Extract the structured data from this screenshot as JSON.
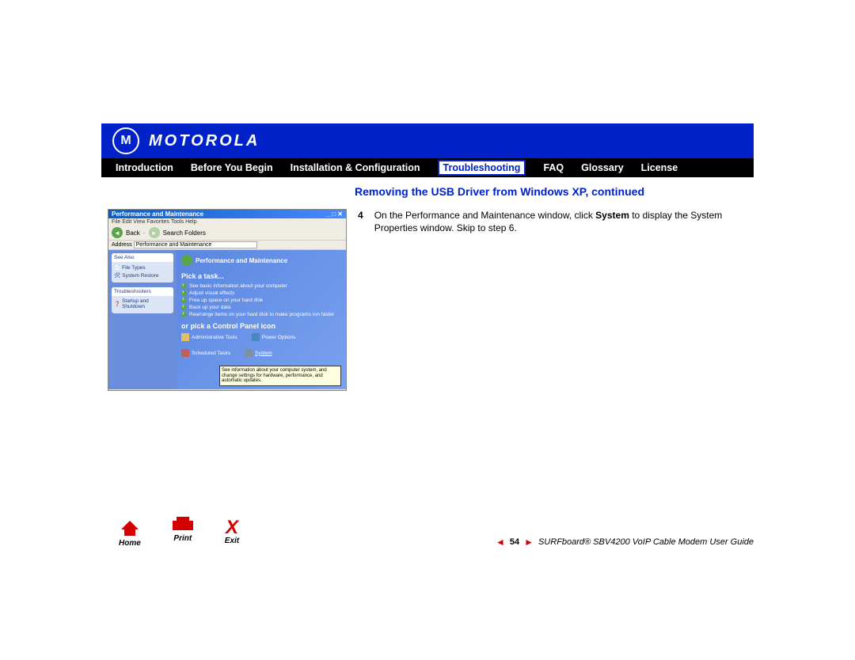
{
  "brand": "MOTOROLA",
  "nav": {
    "items": [
      "Introduction",
      "Before You Begin",
      "Installation & Configuration",
      "Troubleshooting",
      "FAQ",
      "Glossary",
      "License"
    ],
    "active_index": 3
  },
  "section_title": "Removing the USB Driver from Windows XP, continued",
  "step": {
    "number": "4",
    "text_before": "On the Performance and Maintenance window, click ",
    "bold": "System",
    "text_after": " to display the System Properties window. Skip to step 6."
  },
  "xp": {
    "window_title": "Performance and Maintenance",
    "menu": "File   Edit   View   Favorites   Tools   Help",
    "toolbar_back": "Back",
    "toolbar_items": "Search   Folders",
    "addr_label": "Address",
    "addr_value": "Performance and Maintenance",
    "side_see_also": "See Also",
    "side_items1": [
      "File Types",
      "System Restore"
    ],
    "side_trouble": "Troubleshooters",
    "side_items2": [
      "Startup and Shutdown"
    ],
    "main_title": "Performance and Maintenance",
    "pick_task": "Pick a task...",
    "tasks": [
      "See basic information about your computer",
      "Adjust visual effects",
      "Free up space on your hard disk",
      "Back up your data",
      "Rearrange items on your hard disk to make programs run faster"
    ],
    "pick_icon": "or pick a Control Panel icon",
    "cp_icons": [
      "Administrative Tools",
      "Power Options",
      "Scheduled Tasks",
      "System"
    ],
    "tooltip": "See information about your computer system, and change settings for hardware, performance, and automatic updates."
  },
  "footer": {
    "controls": [
      "Home",
      "Print",
      "Exit"
    ],
    "page_number": "54",
    "guide_title": "SURFboard® SBV4200 VoIP Cable Modem User Guide"
  }
}
